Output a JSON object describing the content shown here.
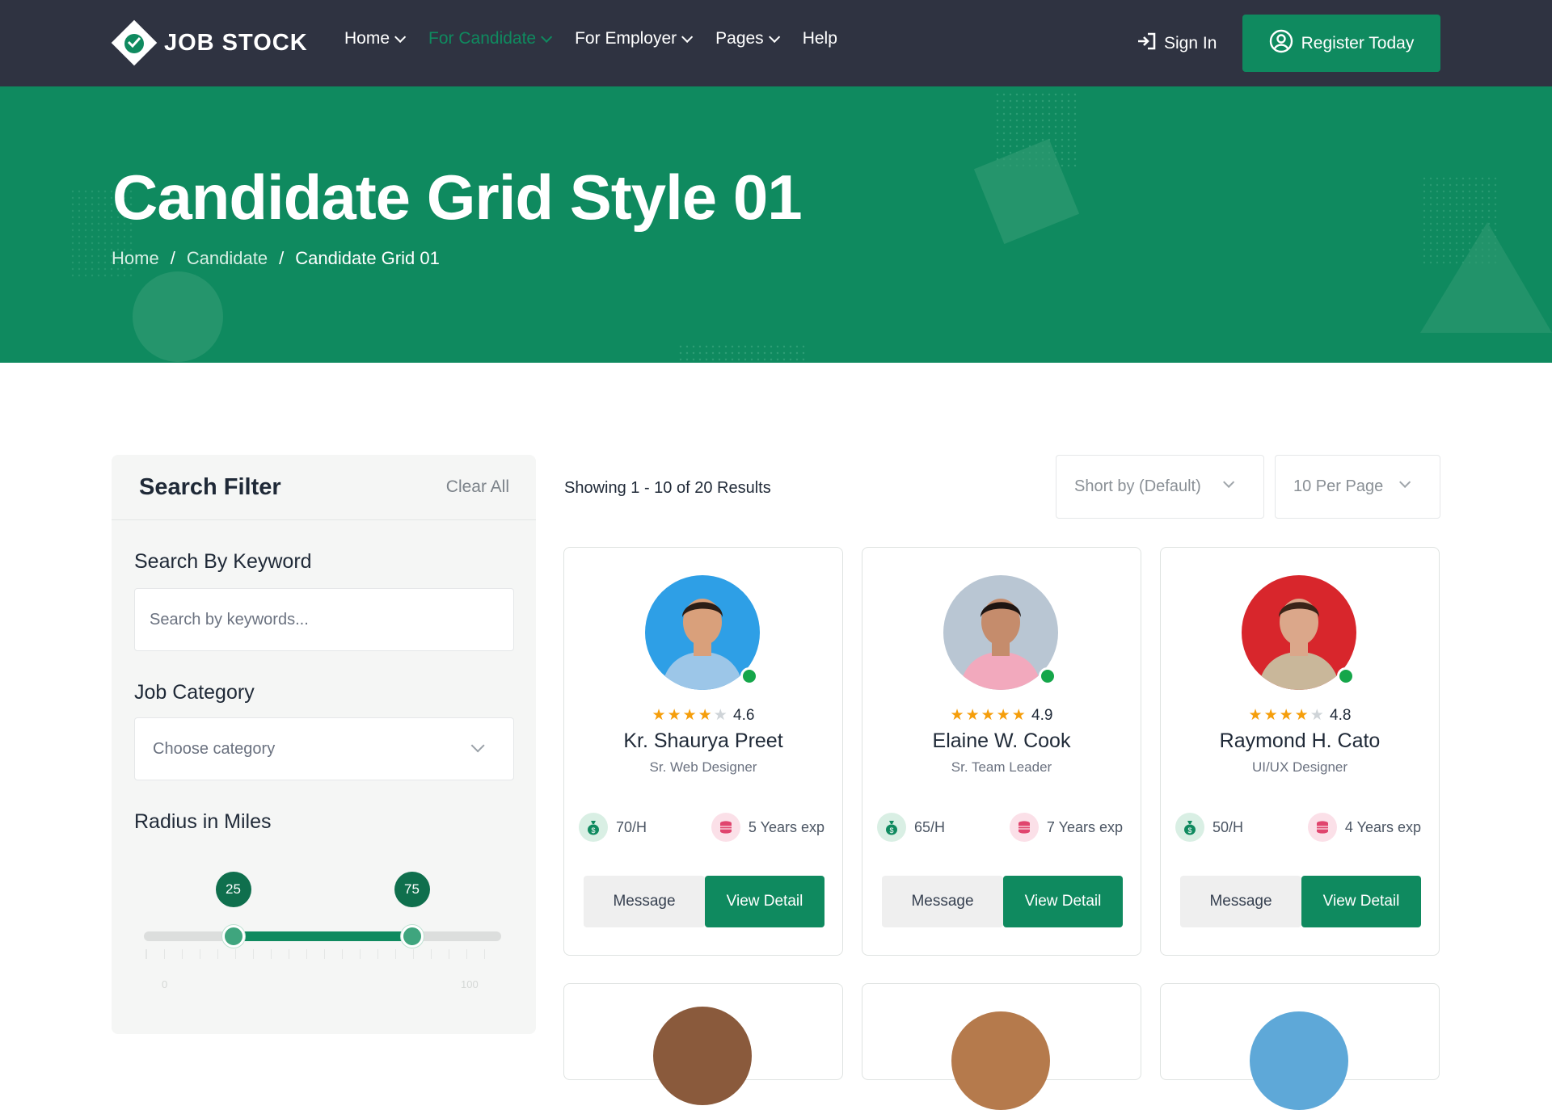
{
  "brand": {
    "name": "JOB STOCK",
    "accent": "#0f8a5f",
    "nav_bg": "#2f3341"
  },
  "nav": {
    "items": [
      {
        "label": "Home"
      },
      {
        "label": "For Candidate"
      },
      {
        "label": "For Employer"
      },
      {
        "label": "Pages"
      },
      {
        "label": "Help"
      }
    ],
    "sign_in": "Sign In",
    "register": "Register Today"
  },
  "hero": {
    "title": "Candidate Grid Style 01",
    "breadcrumb": [
      "Home",
      "Candidate",
      "Candidate Grid 01"
    ],
    "separator": "/"
  },
  "filter": {
    "title": "Search Filter",
    "clear": "Clear All",
    "keyword_label": "Search By Keyword",
    "keyword_placeholder": "Search by keywords...",
    "category_label": "Job Category",
    "category_value": "Choose category",
    "radius_label": "Radius in Miles",
    "radius_min": 25,
    "radius_max": 75,
    "range_min": "0",
    "range_max": "100"
  },
  "results": {
    "text": "Showing 1 - 10 of 20 Results",
    "sort": "Short by (Default)",
    "per_page": "10 Per Page"
  },
  "candidates": [
    {
      "name": "Kr. Shaurya Preet",
      "role": "Sr. Web Designer",
      "rating": "4.6",
      "stars": 4,
      "rate": "70/H",
      "exp": "5 Years exp",
      "msg": "Message",
      "view": "View Detail",
      "bg": "#2e9fe6",
      "shirt": "#9cc6e8",
      "skin": "#d9a07b",
      "hair": "#2b1d16"
    },
    {
      "name": "Elaine W. Cook",
      "role": "Sr. Team Leader",
      "rating": "4.9",
      "stars": 5,
      "rate": "65/H",
      "exp": "7 Years exp",
      "msg": "Message",
      "view": "View Detail",
      "bg": "#b9c6d3",
      "shirt": "#f2a9bd",
      "skin": "#c58c6c",
      "hair": "#1e1512"
    },
    {
      "name": "Raymond H. Cato",
      "role": "UI/UX Designer",
      "rating": "4.8",
      "stars": 4,
      "rate": "50/H",
      "exp": "4 Years exp",
      "msg": "Message",
      "view": "View Detail",
      "bg": "#d8262c",
      "shirt": "#c9b79a",
      "skin": "#dba78a",
      "hair": "#3a2418"
    }
  ]
}
